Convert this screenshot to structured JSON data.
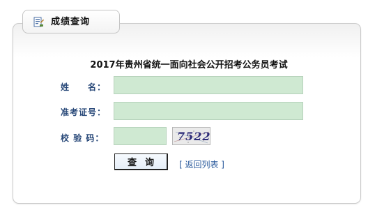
{
  "tab": {
    "icon": "document-form-icon",
    "title": "成绩查询"
  },
  "form": {
    "exam_title": "2017年贵州省统一面向社会公开招考公务员考试",
    "name_label": "姓　　名：",
    "name_value": "",
    "exam_id_label": "准考证号：",
    "exam_id_value": "",
    "captcha_label": "校 验 码：",
    "captcha_value": "",
    "captcha_image_text": "7522",
    "query_button": "查询",
    "back_link": "[ 返回列表 ]"
  },
  "colors": {
    "input_bg": "#cfe9d2",
    "label": "#2a4a7a",
    "link": "#2a5a9c",
    "captcha_text": "#2d2b78"
  }
}
